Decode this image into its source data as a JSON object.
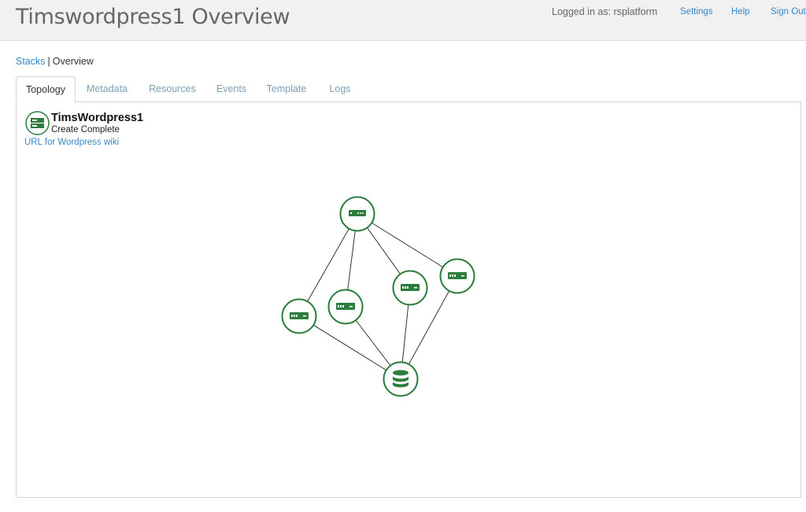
{
  "header": {
    "title": "Timswordpress1 Overview",
    "logged_in": "Logged in as: rsplatform",
    "settings": "Settings",
    "help": "Help",
    "sign_out": "Sign Out"
  },
  "breadcrumb": {
    "stacks": "Stacks",
    "separator": "|",
    "current": "Overview"
  },
  "tabs": [
    {
      "label": "Topology",
      "active": true
    },
    {
      "label": "Metadata",
      "active": false
    },
    {
      "label": "Resources",
      "active": false
    },
    {
      "label": "Events",
      "active": false
    },
    {
      "label": "Template",
      "active": false
    },
    {
      "label": "Logs",
      "active": false
    }
  ],
  "stack": {
    "name": "TimsWordpress1",
    "status": "Create Complete",
    "url_label": "URL for Wordpress wiki",
    "icon": "server-icon"
  },
  "topology": {
    "node_color": "#2d7d3e",
    "nodes": [
      {
        "name": "load-balancer-node",
        "icon": "load-balancer-icon"
      },
      {
        "name": "server-node",
        "icon": "server-icon"
      },
      {
        "name": "server-node",
        "icon": "server-icon"
      },
      {
        "name": "server-node",
        "icon": "server-icon"
      },
      {
        "name": "server-node",
        "icon": "server-icon"
      },
      {
        "name": "database-node",
        "icon": "database-icon"
      }
    ]
  }
}
